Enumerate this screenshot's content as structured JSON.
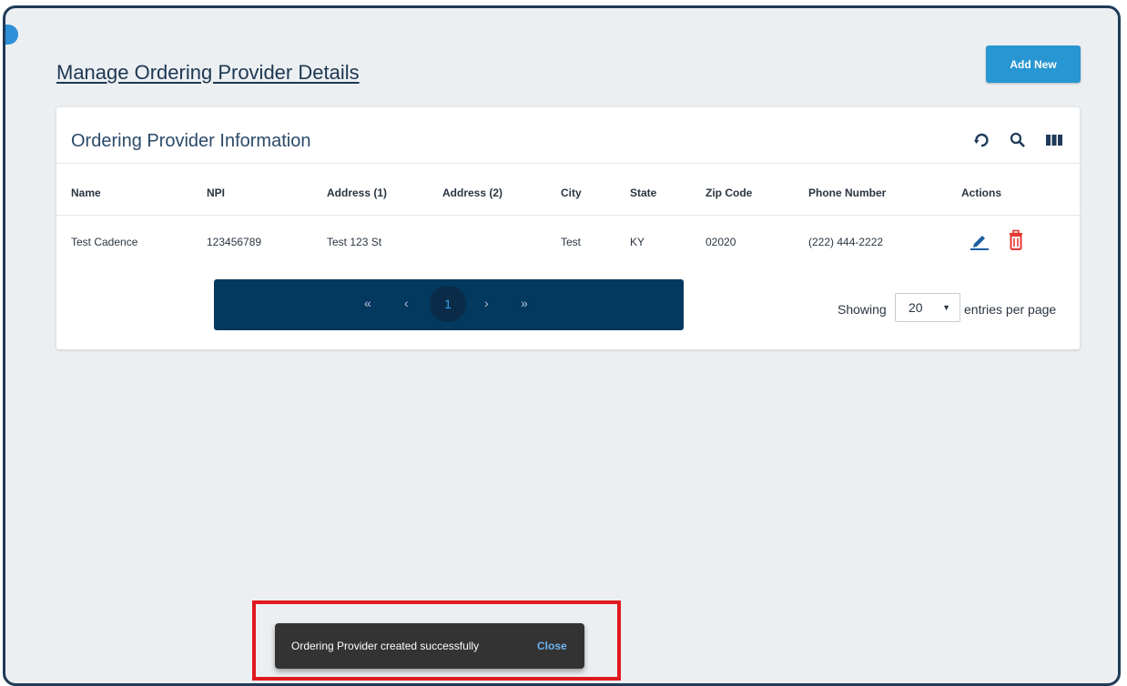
{
  "page": {
    "title": "Manage Ordering Provider Details",
    "add_new_label": "Add New"
  },
  "card": {
    "title": "Ordering Provider Information",
    "icons": [
      "refresh-icon",
      "search-icon",
      "columns-icon"
    ]
  },
  "table": {
    "columns": [
      "Name",
      "NPI",
      "Address (1)",
      "Address (2)",
      "City",
      "State",
      "Zip Code",
      "Phone Number",
      "Actions"
    ],
    "rows": [
      {
        "name": "Test Cadence",
        "npi": "123456789",
        "address1": "Test 123 St",
        "address2": "",
        "city": "Test",
        "state": "KY",
        "zip": "02020",
        "phone": "(222) 444-2222",
        "actions": [
          "edit-icon",
          "delete-icon"
        ]
      }
    ]
  },
  "pagination": {
    "first": "«",
    "prev": "‹",
    "current_page": "1",
    "next": "›",
    "last": "»",
    "showing_label": "Showing",
    "per_page_value": "20",
    "entries_label": "entries per page"
  },
  "toast": {
    "message": "Ordering Provider created successfully",
    "close_label": "Close"
  },
  "colors": {
    "primary": "#2796d2",
    "navy": "#03385f",
    "delete": "#e53935",
    "highlight": "#e0191f"
  }
}
